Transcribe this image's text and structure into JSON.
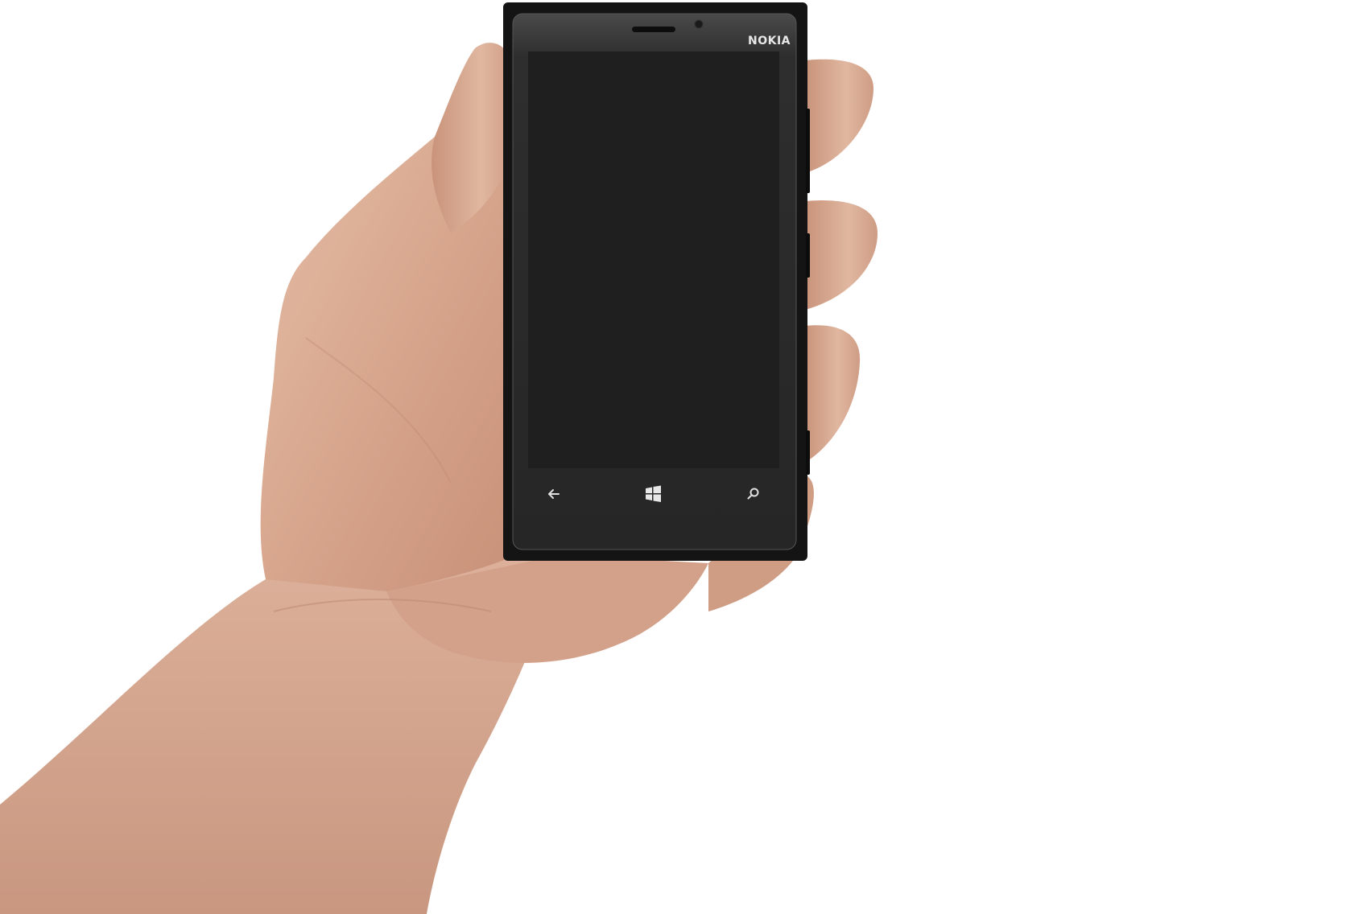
{
  "phone": {
    "brand": "NOKIA",
    "body_color": "#141414",
    "screen_color": "#1f1f1f",
    "nav_buttons": [
      {
        "name": "back-button",
        "icon": "back-arrow-icon"
      },
      {
        "name": "start-button",
        "icon": "windows-logo-icon"
      },
      {
        "name": "search-button",
        "icon": "search-icon"
      }
    ]
  },
  "scene": {
    "background": "#ffffff",
    "skin_color": "#d9ad96"
  }
}
